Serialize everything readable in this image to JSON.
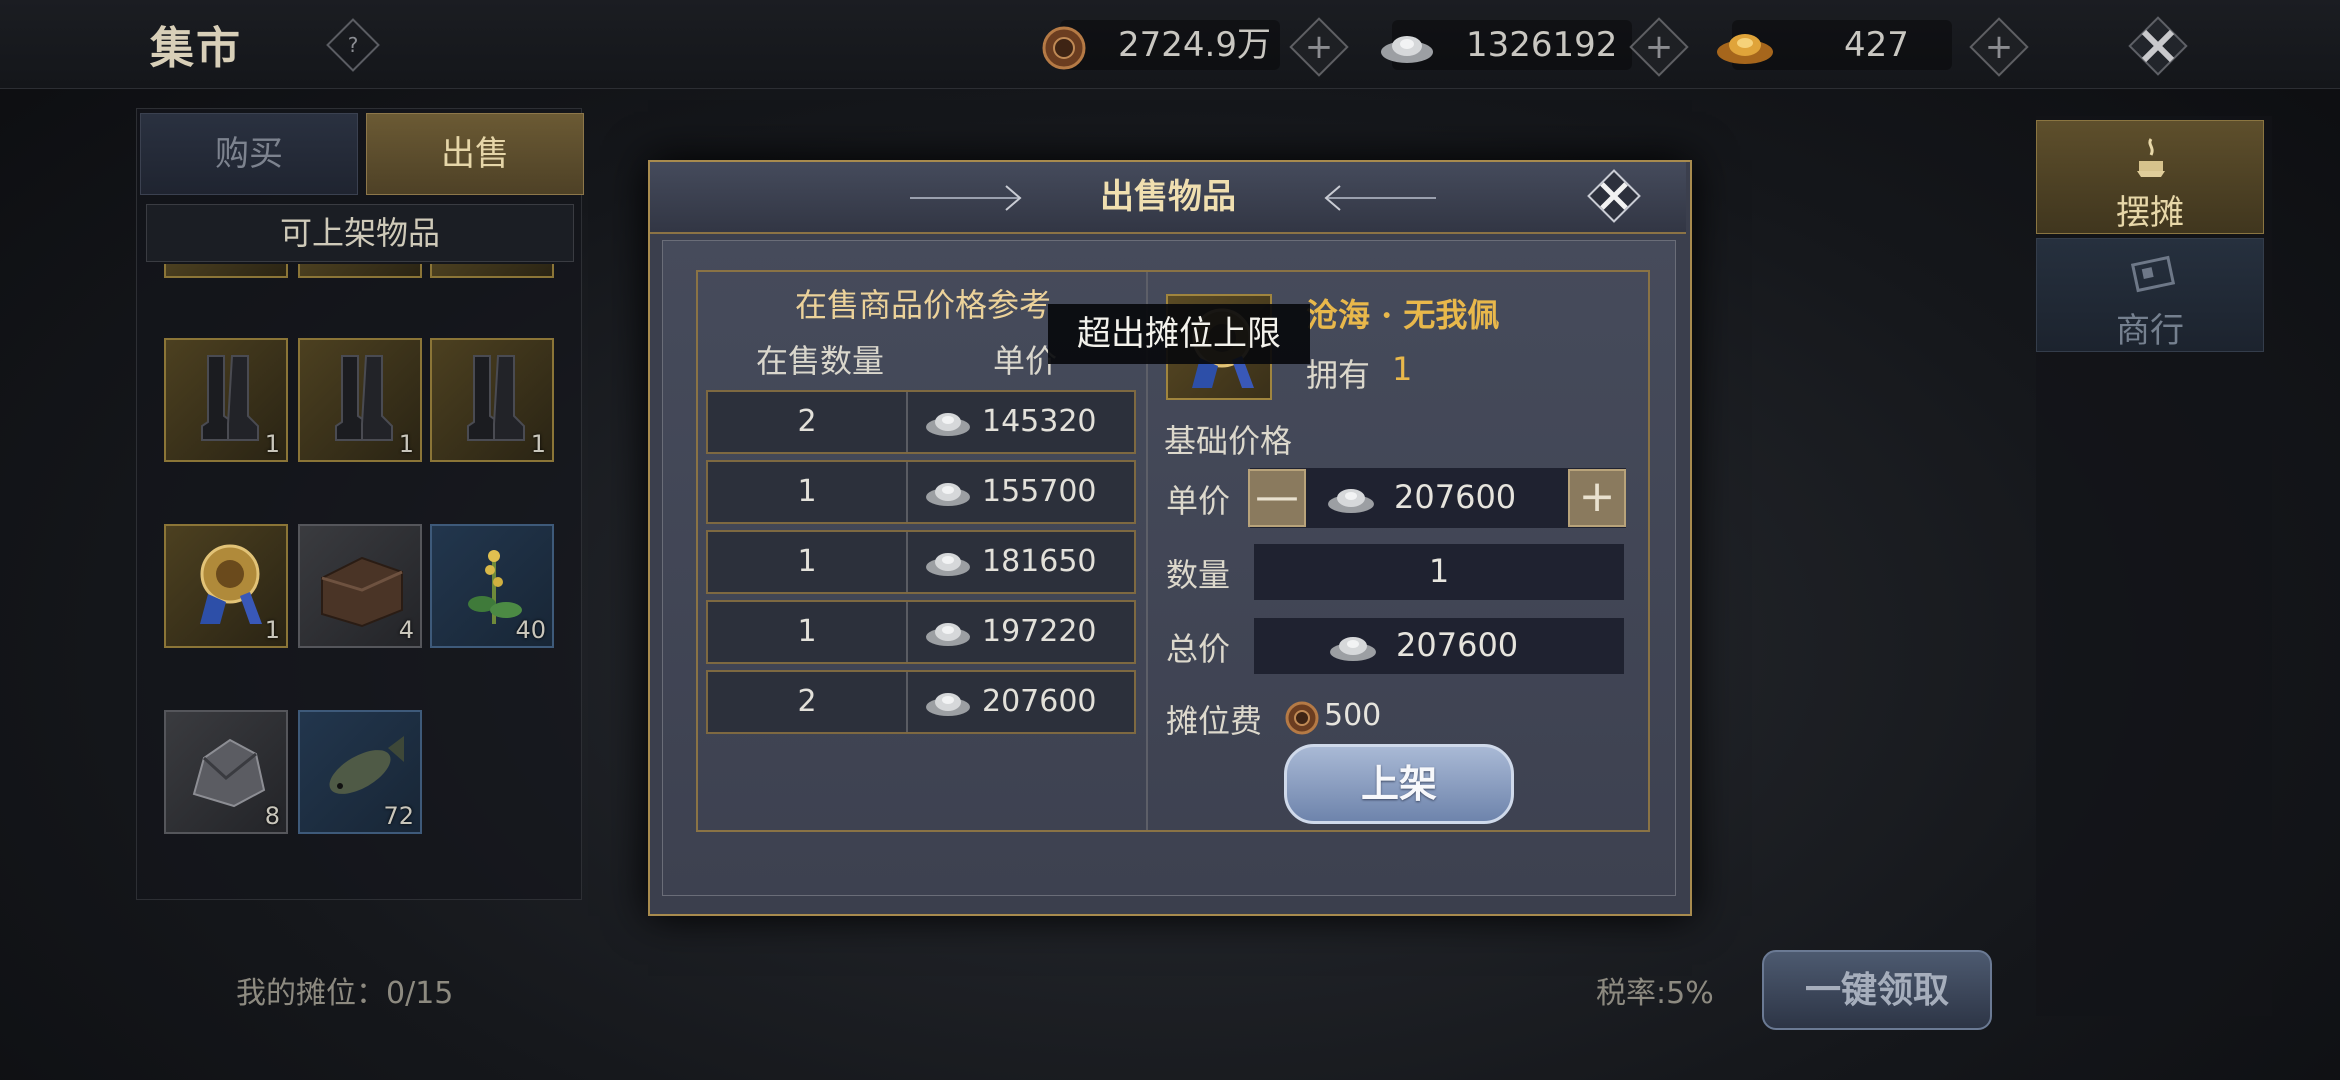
{
  "header": {
    "title": "集市",
    "help_label": "?",
    "currencies": [
      {
        "icon": "copper-coin-icon",
        "value": "2724.9万"
      },
      {
        "icon": "silver-ingot-icon",
        "value": "1326192"
      },
      {
        "icon": "gold-ingot-icon",
        "value": "427"
      }
    ],
    "plus_label": "+",
    "close_icon": "close-icon"
  },
  "left": {
    "tabs": [
      {
        "label": "购买"
      },
      {
        "label": "出售"
      }
    ],
    "active_tab": "出售",
    "section_title": "可上架物品",
    "items": [
      {
        "icon": "boots-icon",
        "count": "1",
        "rarity": "gold"
      },
      {
        "icon": "boots-icon",
        "count": "1",
        "rarity": "gold"
      },
      {
        "icon": "boots-icon",
        "count": "1",
        "rarity": "gold"
      },
      {
        "icon": "pendant-icon",
        "count": "1",
        "rarity": "gold"
      },
      {
        "icon": "chest-icon",
        "count": "4",
        "rarity": "grey"
      },
      {
        "icon": "herb-icon",
        "count": "40",
        "rarity": "blue"
      },
      {
        "icon": "ore-icon",
        "count": "8",
        "rarity": "grey"
      },
      {
        "icon": "fish-icon",
        "count": "72",
        "rarity": "blue"
      }
    ]
  },
  "right": {
    "tabs": [
      {
        "label": "摆摊",
        "icon": "stall-icon"
      },
      {
        "label": "商行",
        "icon": "shop-icon"
      }
    ]
  },
  "footer": {
    "my_stall": "我的摊位：0/15",
    "tax": "税率:5%",
    "collect_all": "一键领取"
  },
  "dialog": {
    "title": "出售物品",
    "reference": {
      "title": "在售商品价格参考",
      "col_qty": "在售数量",
      "col_price": "单价",
      "rows": [
        {
          "qty": "2",
          "price": "145320"
        },
        {
          "qty": "1",
          "price": "155700"
        },
        {
          "qty": "1",
          "price": "181650"
        },
        {
          "qty": "1",
          "price": "197220"
        },
        {
          "qty": "2",
          "price": "207600"
        }
      ]
    },
    "tooltip": "超出摊位上限",
    "item": {
      "name": "沧海 · 无我佩",
      "owned_label": "拥有",
      "owned_value": "1"
    },
    "base_price_label": "基础价格",
    "unit_price_label": "单价",
    "unit_price": "207600",
    "quantity_label": "数量",
    "quantity": "1",
    "total_label": "总价",
    "total": "207600",
    "stall_fee_label": "摊位费",
    "stall_fee": "500",
    "minus_label": "—",
    "plus_label": "+",
    "submit": "上架"
  },
  "colors": {
    "accent_gold": "#e9b84b",
    "title_gold": "#f0dfb0",
    "button_blue": "#8ea1c4"
  }
}
